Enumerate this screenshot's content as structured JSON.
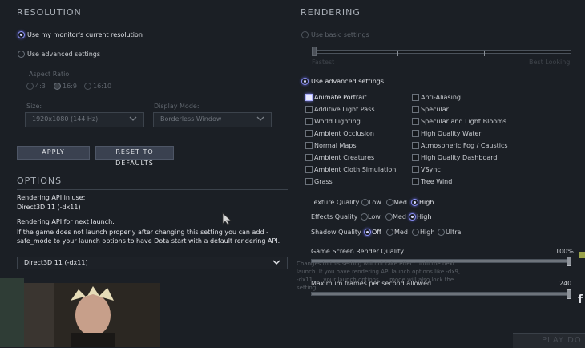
{
  "resolution": {
    "title": "RESOLUTION",
    "use_monitor_label": "Use my monitor's current resolution",
    "use_advanced_label": "Use advanced settings",
    "aspect_ratio_label": "Aspect Ratio",
    "aspect_options": [
      "4:3",
      "16:9",
      "16:10"
    ],
    "size_label": "Size:",
    "size_value": "1920x1080 (144 Hz)",
    "display_mode_label": "Display Mode:",
    "display_mode_value": "Borderless Window",
    "apply_label": "APPLY",
    "reset_label": "RESET TO DEFAULTS"
  },
  "options": {
    "title": "OPTIONS",
    "api_in_use_label": "Rendering API in use:",
    "api_in_use_value": "Direct3D 11 (-dx11)",
    "api_next_label": "Rendering API for next launch:",
    "api_next_note": "If the game does not launch properly after changing this setting you can add -safe_mode to your launch options to have Dota start with a default rendering API.",
    "api_select_value": "Direct3D 11 (-dx11)",
    "overlay_note": "Changes to this setting will not take effect until the next launch. If you have rendering API launch options like -dx9, -dx11, ... your launch options, ... mode will also lock the setting."
  },
  "rendering": {
    "title": "RENDERING",
    "use_basic_label": "Use basic settings",
    "slider_min_label": "Fastest",
    "slider_max_label": "Best Looking",
    "use_advanced_label": "Use advanced settings",
    "checkboxes_left": [
      {
        "label": "Animate Portrait",
        "checked": true
      },
      {
        "label": "Additive Light Pass",
        "checked": false
      },
      {
        "label": "World Lighting",
        "checked": false
      },
      {
        "label": "Ambient Occlusion",
        "checked": false
      },
      {
        "label": "Normal Maps",
        "checked": false
      },
      {
        "label": "Ambient Creatures",
        "checked": false
      },
      {
        "label": "Ambient Cloth Simulation",
        "checked": false
      },
      {
        "label": "Grass",
        "checked": false
      }
    ],
    "checkboxes_right": [
      {
        "label": "Anti-Aliasing",
        "checked": false
      },
      {
        "label": "Specular",
        "checked": false
      },
      {
        "label": "Specular and Light Blooms",
        "checked": false
      },
      {
        "label": "High Quality Water",
        "checked": false
      },
      {
        "label": "Atmospheric Fog / Caustics",
        "checked": false
      },
      {
        "label": "High Quality Dashboard",
        "checked": false
      },
      {
        "label": "VSync",
        "checked": false
      },
      {
        "label": "Tree Wind",
        "checked": false
      }
    ],
    "texture_quality_label": "Texture Quality",
    "texture_options": [
      "Low",
      "Med",
      "High"
    ],
    "texture_selected": "High",
    "effects_quality_label": "Effects Quality",
    "effects_options": [
      "Low",
      "Med",
      "High"
    ],
    "effects_selected": "High",
    "shadow_quality_label": "Shadow Quality",
    "shadow_options": [
      "Off",
      "Med",
      "High",
      "Ultra"
    ],
    "shadow_selected": "Off",
    "render_quality_label": "Game Screen Render Quality",
    "render_quality_value": "100%",
    "render_quality_fraction": 1.0,
    "max_fps_label": "Maximum frames per second allowed",
    "max_fps_value": "240",
    "max_fps_fraction": 1.0
  },
  "edge": {
    "play_label": "PLAY DO"
  }
}
